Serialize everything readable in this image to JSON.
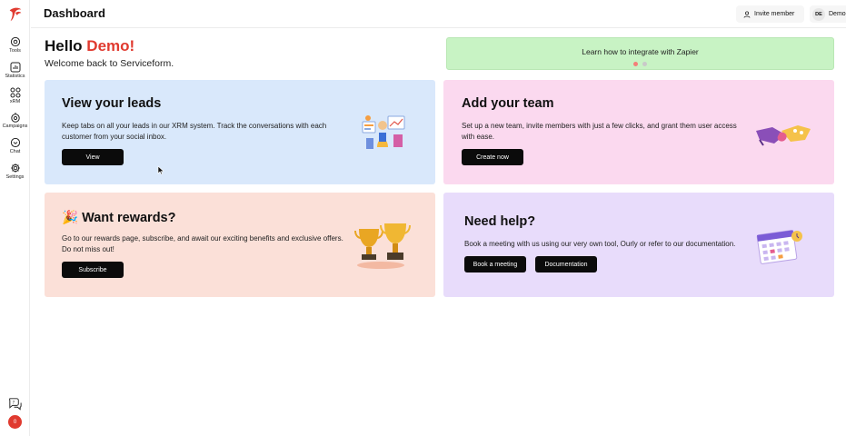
{
  "sidebar": {
    "items": [
      {
        "label": "Tools",
        "icon": "tools-icon"
      },
      {
        "label": "Statistics",
        "icon": "statistics-icon"
      },
      {
        "label": "xRM",
        "icon": "xrm-icon"
      },
      {
        "label": "Campaigns",
        "icon": "campaigns-icon"
      },
      {
        "label": "Chat",
        "icon": "chat-icon"
      },
      {
        "label": "Settings",
        "icon": "settings-icon"
      }
    ],
    "avatar_initial": "0"
  },
  "header": {
    "title": "Dashboard",
    "invite_label": "Invite member",
    "user_initials": "DE",
    "user_name": "Demo"
  },
  "greeting": {
    "hello": "Hello",
    "name": "Demo!",
    "welcome": "Welcome back to Serviceform."
  },
  "banner": {
    "text": "Learn how to integrate with Zapier",
    "dots": 2,
    "active_dot": 1
  },
  "cards": {
    "leads": {
      "title": "View your leads",
      "description": "Keep tabs on all your leads in our XRM system. Track the conversations with each customer from your social inbox.",
      "button": "View"
    },
    "team": {
      "title": "Add your team",
      "description": "Set up a new team, invite members with just a few clicks, and grant them user access with ease.",
      "button": "Create now"
    },
    "rewards": {
      "title": "🎉 Want rewards?",
      "description": "Go to our rewards page, subscribe, and await our exciting benefits and exclusive offers. Do not miss out!",
      "button": "Subscribe"
    },
    "help": {
      "title": "Need help?",
      "description": "Book a meeting with us using our very own tool, Ourly or refer to our documentation.",
      "button_primary": "Book a meeting",
      "button_secondary": "Documentation"
    }
  },
  "colors": {
    "accent": "#e03a2f",
    "leads_bg": "#d9e8fb",
    "team_bg": "#fbd9ef",
    "rewards_bg": "#fbe0d8",
    "help_bg": "#e8dcfb",
    "banner_bg": "#c8f3c4"
  }
}
